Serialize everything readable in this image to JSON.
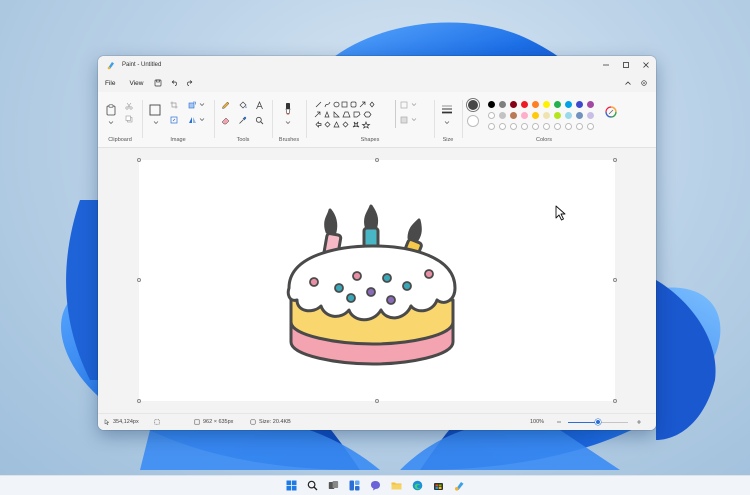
{
  "window": {
    "title": "Paint - Untitled"
  },
  "menu": {
    "file": "File",
    "view": "View"
  },
  "ribbon": {
    "groups": {
      "clipboard": "Clipboard",
      "image": "Image",
      "tools": "Tools",
      "brushes": "Brushes",
      "shapes": "Shapes",
      "size": "Size",
      "colors": "Colors"
    },
    "colors": {
      "primary": "#484848",
      "secondary": "#ffffff",
      "palette_row1": [
        "#000000",
        "#7f7f7f",
        "#880015",
        "#ed1c24",
        "#ff7f27",
        "#fff200",
        "#22b14c",
        "#00a2e8",
        "#3f48cc",
        "#a349a4"
      ],
      "palette_row2": [
        "#ffffff",
        "#c3c3c3",
        "#b97a57",
        "#ffaec9",
        "#ffc90e",
        "#efe4b0",
        "#b5e61d",
        "#99d9ea",
        "#7092be",
        "#c8bfe7"
      ]
    }
  },
  "status": {
    "cursor_position": "354,124px",
    "selection_size": "962 × 635px",
    "file_size": "Size: 20.4KB",
    "zoom": "100%"
  },
  "drawing": {
    "subject": "birthday-cake",
    "cake_colors": {
      "outline": "#4a4a4a",
      "frosting": "#ffffff",
      "sponge": "#f9d66e",
      "base": "#f4a3b0",
      "candle_pink": "#f6b9c5",
      "candle_teal": "#49b6c5",
      "candle_yellow": "#f7c94a",
      "dot_teal": "#3aa7b8",
      "dot_pink": "#e88fa6",
      "dot_purple": "#8a6bb8"
    }
  },
  "taskbar": {
    "icons": [
      "start-icon",
      "search-icon",
      "task-view-icon",
      "widgets-icon",
      "chat-icon",
      "file-explorer-icon",
      "edge-icon",
      "store-icon",
      "paint-icon"
    ]
  }
}
